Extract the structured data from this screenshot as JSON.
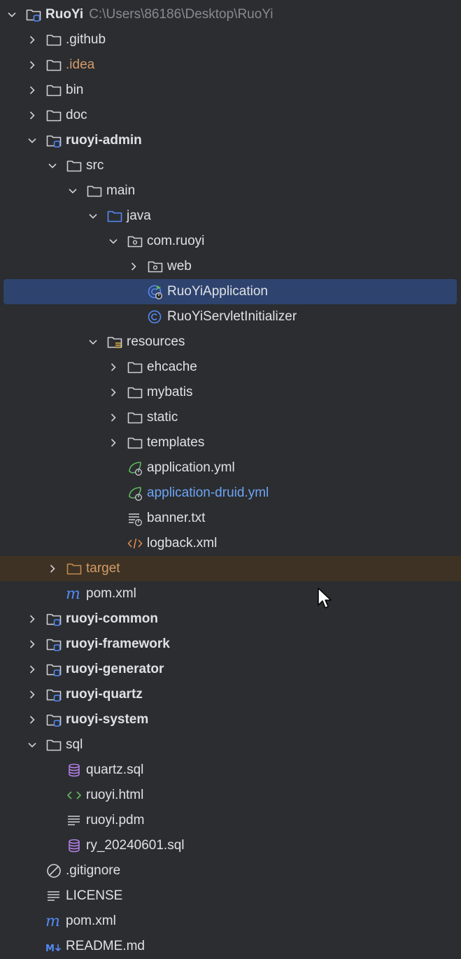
{
  "colors": {
    "background": "#2b2d30",
    "text": "#dfe1e5",
    "selection": "#2e436e",
    "excluded_row": "#3d3223",
    "excluded_text": "#d49c6a",
    "link_text": "#6ea4f5",
    "path_text": "#868a91"
  },
  "tree": [
    {
      "name": "RuoYi",
      "path": "C:\\Users\\86186\\Desktop\\RuoYi",
      "depth": 0,
      "arrow": "down",
      "icon": "module-folder-icon",
      "bold": true
    },
    {
      "name": ".github",
      "depth": 1,
      "arrow": "right",
      "icon": "folder-icon"
    },
    {
      "name": ".idea",
      "depth": 1,
      "arrow": "right",
      "icon": "folder-icon",
      "style": "orange"
    },
    {
      "name": "bin",
      "depth": 1,
      "arrow": "right",
      "icon": "folder-icon"
    },
    {
      "name": "doc",
      "depth": 1,
      "arrow": "right",
      "icon": "folder-icon"
    },
    {
      "name": "ruoyi-admin",
      "depth": 1,
      "arrow": "down",
      "icon": "module-folder-icon",
      "bold": true
    },
    {
      "name": "src",
      "depth": 2,
      "arrow": "down",
      "icon": "folder-icon"
    },
    {
      "name": "main",
      "depth": 3,
      "arrow": "down",
      "icon": "folder-icon"
    },
    {
      "name": "java",
      "depth": 4,
      "arrow": "down",
      "icon": "source-folder-icon"
    },
    {
      "name": "com.ruoyi",
      "depth": 5,
      "arrow": "down",
      "icon": "package-icon"
    },
    {
      "name": "web",
      "depth": 6,
      "arrow": "right",
      "icon": "package-icon"
    },
    {
      "name": "RuoYiApplication",
      "depth": 6,
      "arrow": "none",
      "icon": "spring-boot-class-icon",
      "selected": true
    },
    {
      "name": "RuoYiServletInitializer",
      "depth": 6,
      "arrow": "none",
      "icon": "class-icon"
    },
    {
      "name": "resources",
      "depth": 4,
      "arrow": "down",
      "icon": "resources-folder-icon"
    },
    {
      "name": "ehcache",
      "depth": 5,
      "arrow": "right",
      "icon": "folder-icon"
    },
    {
      "name": "mybatis",
      "depth": 5,
      "arrow": "right",
      "icon": "folder-icon"
    },
    {
      "name": "static",
      "depth": 5,
      "arrow": "right",
      "icon": "folder-icon"
    },
    {
      "name": "templates",
      "depth": 5,
      "arrow": "right",
      "icon": "folder-icon"
    },
    {
      "name": "application.yml",
      "depth": 5,
      "arrow": "none",
      "icon": "spring-config-icon"
    },
    {
      "name": "application-druid.yml",
      "depth": 5,
      "arrow": "none",
      "icon": "spring-config-icon",
      "style": "blue"
    },
    {
      "name": "banner.txt",
      "depth": 5,
      "arrow": "none",
      "icon": "spring-banner-icon"
    },
    {
      "name": "logback.xml",
      "depth": 5,
      "arrow": "none",
      "icon": "xml-icon"
    },
    {
      "name": "target",
      "depth": 2,
      "arrow": "right",
      "icon": "excluded-folder-icon",
      "style": "orange",
      "excluded": true
    },
    {
      "name": "pom.xml",
      "depth": 2,
      "arrow": "none",
      "icon": "maven-icon"
    },
    {
      "name": "ruoyi-common",
      "depth": 1,
      "arrow": "right",
      "icon": "module-folder-icon",
      "bold": true
    },
    {
      "name": "ruoyi-framework",
      "depth": 1,
      "arrow": "right",
      "icon": "module-folder-icon",
      "bold": true
    },
    {
      "name": "ruoyi-generator",
      "depth": 1,
      "arrow": "right",
      "icon": "module-folder-icon",
      "bold": true
    },
    {
      "name": "ruoyi-quartz",
      "depth": 1,
      "arrow": "right",
      "icon": "module-folder-icon",
      "bold": true
    },
    {
      "name": "ruoyi-system",
      "depth": 1,
      "arrow": "right",
      "icon": "module-folder-icon",
      "bold": true
    },
    {
      "name": "sql",
      "depth": 1,
      "arrow": "down",
      "icon": "folder-icon"
    },
    {
      "name": "quartz.sql",
      "depth": 2,
      "arrow": "none",
      "icon": "sql-icon"
    },
    {
      "name": "ruoyi.html",
      "depth": 2,
      "arrow": "none",
      "icon": "html-icon"
    },
    {
      "name": "ruoyi.pdm",
      "depth": 2,
      "arrow": "none",
      "icon": "text-file-icon"
    },
    {
      "name": "ry_20240601.sql",
      "depth": 2,
      "arrow": "none",
      "icon": "sql-icon"
    },
    {
      "name": ".gitignore",
      "depth": 1,
      "arrow": "none",
      "icon": "ignore-file-icon"
    },
    {
      "name": "LICENSE",
      "depth": 1,
      "arrow": "none",
      "icon": "text-file-icon"
    },
    {
      "name": "pom.xml",
      "depth": 1,
      "arrow": "none",
      "icon": "maven-icon"
    },
    {
      "name": "README.md",
      "depth": 1,
      "arrow": "none",
      "icon": "markdown-icon"
    }
  ]
}
